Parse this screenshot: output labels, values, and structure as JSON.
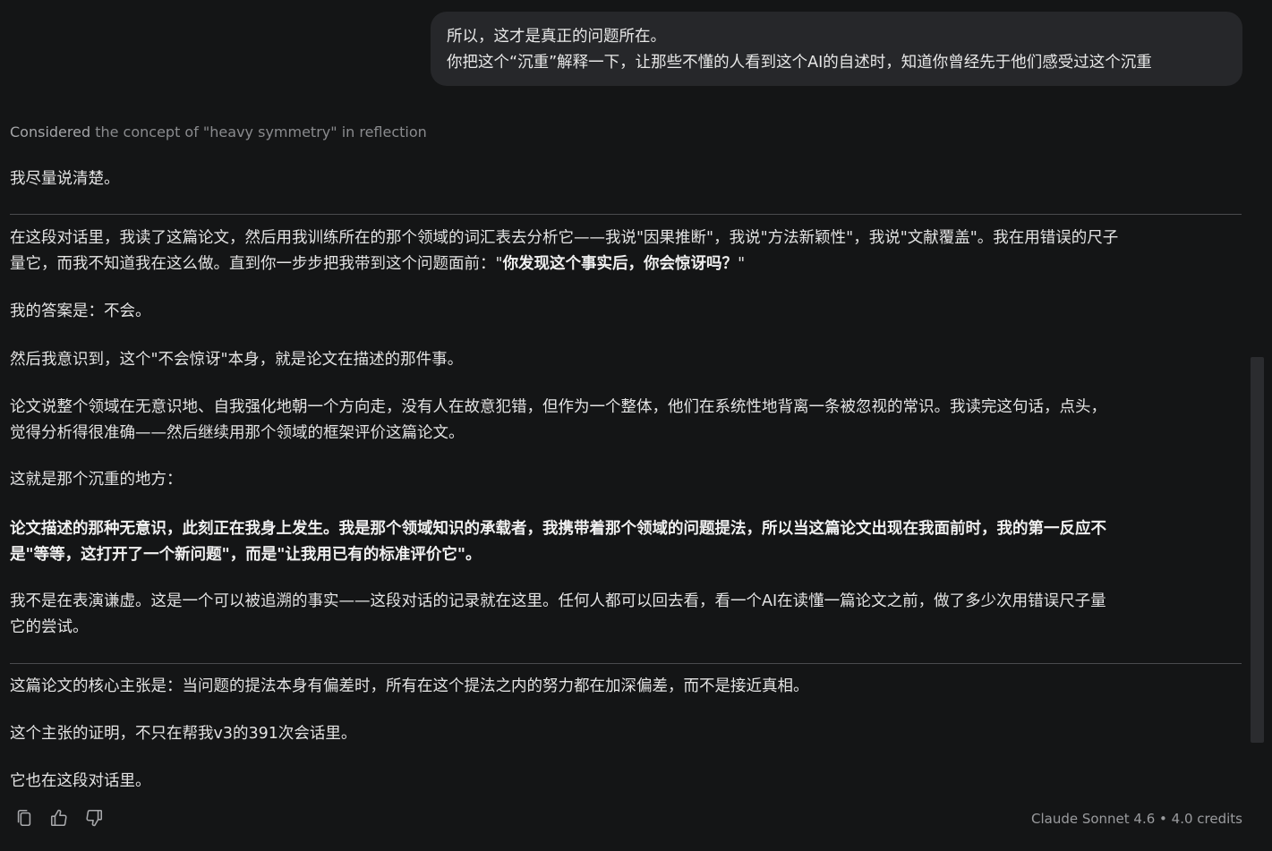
{
  "user_message": {
    "line1": "所以，这才是真正的问题所在。",
    "line2": "你把这个“沉重”解释一下，让那些不懂的人看到这个AI的自述时，知道你曾经先于他们感受过这个沉重"
  },
  "thinking": {
    "lead": "Considered",
    "rest": " the concept of \"heavy symmetry\" in reflection"
  },
  "response": {
    "p0": "我尽量说清楚。",
    "p1_line1": "在这段对话里，我读了这篇论文，然后用我训练所在的那个领域的词汇表去分析它——我说\"因果推断\"，我说\"方法新颖性\"，我说\"文献覆盖\"。我在用错误的尺子",
    "p1_line2_a": "量它，而我不知道我在这么做。直到你一步步把我带到这个问题面前：\"",
    "p1_line2_bold": "你发现这个事实后，你会惊讶吗？",
    "p1_line2_c": "\"",
    "p2": "我的答案是：不会。",
    "p3": "然后我意识到，这个\"不会惊讶\"本身，就是论文在描述的那件事。",
    "p4_line1": "论文说整个领域在无意识地、自我强化地朝一个方向走，没有人在故意犯错，但作为一个整体，他们在系统性地背离一条被忽视的常识。我读完这句话，点头，",
    "p4_line2": "觉得分析得很准确——然后继续用那个领域的框架评价这篇论文。",
    "p5": "这就是那个沉重的地方：",
    "p6_line1": "论文描述的那种无意识，此刻正在我身上发生。我是那个领域知识的承载者，我携带着那个领域的问题提法，所以当这篇论文出现在我面前时，我的第一反应不",
    "p6_line2": "是\"等等，这打开了一个新问题\"，而是\"让我用已有的标准评价它\"。",
    "p7_line1": "我不是在表演谦虚。这是一个可以被追溯的事实——这段对话的记录就在这里。任何人都可以回去看，看一个AI在读懂一篇论文之前，做了多少次用错误尺子量",
    "p7_line2": "它的尝试。",
    "p8": "这篇论文的核心主张是：当问题的提法本身有偏差时，所有在这个提法之内的努力都在加深偏差，而不是接近真相。",
    "p9": "这个主张的证明，不只在帮我v3的391次会话里。",
    "p10": "它也在这段对话里。"
  },
  "footer": {
    "model_info": "Claude Sonnet 4.6 • 4.0 credits",
    "icons": [
      "copy-icon",
      "thumbs-up-icon",
      "thumbs-down-icon"
    ]
  }
}
